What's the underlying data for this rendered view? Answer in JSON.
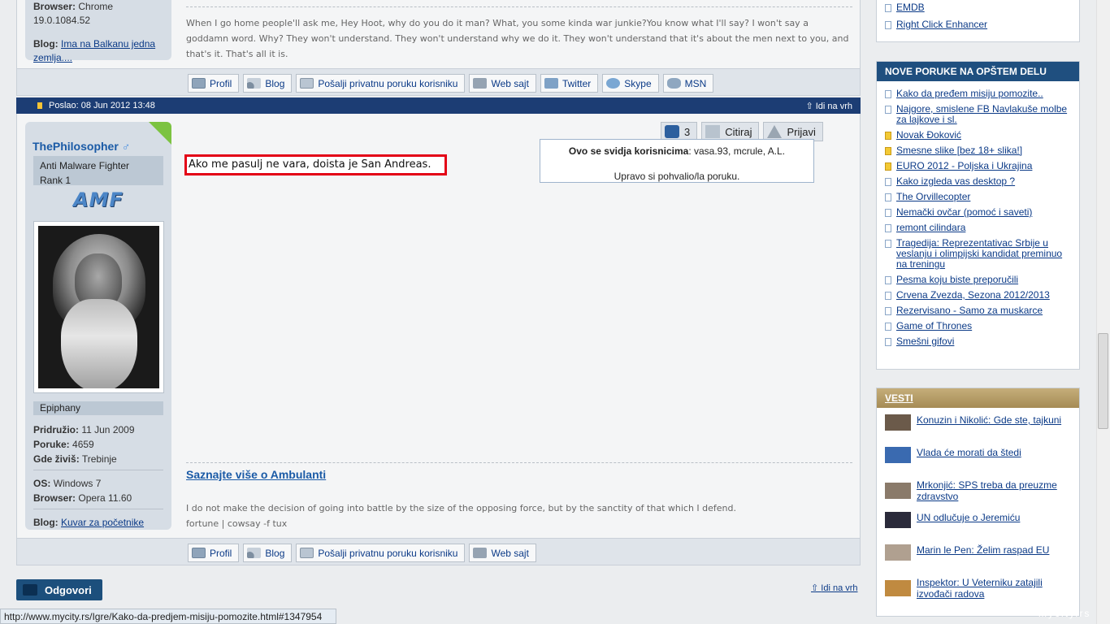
{
  "prev_post": {
    "browser_label": "Browser:",
    "browser_value": "Chrome 19.0.1084.52",
    "blog_label": "Blog:",
    "blog_link": "Ima na Balkanu jedna zemlja....",
    "signature": "When I go home people'll ask me, Hey Hoot, why do you do it man? What, you some kinda war junkie?You know what I'll say? I won't say a goddamn word. Why? They won't understand. They won't understand why we do it. They won't understand that it's about the men next to you, and that's it. That's all it is."
  },
  "buttons_top": [
    "Profil",
    "Blog",
    "Pošalji privatnu poruku korisniku",
    "Web sajt",
    "Twitter",
    "Skype",
    "MSN"
  ],
  "buttons_bottom": [
    "Profil",
    "Blog",
    "Pošalji privatnu poruku korisniku",
    "Web sajt"
  ],
  "post_header": {
    "date": "Poslao: 08 Jun 2012 13:48",
    "top_link": "Idi na vrh"
  },
  "user": {
    "name": "ThePhilosopher",
    "sex_symbol": "♂",
    "rank_line1": "Anti Malware Fighter",
    "rank_line2": "Rank 1",
    "badge": "AMF",
    "title": "Epiphany",
    "joined_label": "Pridružio:",
    "joined": "11 Jun 2009",
    "posts_label": "Poruke:",
    "posts": "4659",
    "location_label": "Gde živiš:",
    "location": "Trebinje",
    "os_label": "OS:",
    "os": "Windows 7",
    "browser_label": "Browser:",
    "browser": "Opera 11.60",
    "blog_label": "Blog:",
    "blog_link": "Kuvar za početnike"
  },
  "actions": {
    "like_count": "3",
    "quote": "Citiraj",
    "report": "Prijavi"
  },
  "message": "Ako me pasulj ne vara, doista je San Andreas.",
  "like_popup": {
    "label": "Ovo se svidja korisnicima",
    "users": "vasa.93, mcrule, A.L.",
    "note": "Upravo si pohvalio/la poruku."
  },
  "signature": {
    "link": "Saznajte više o Ambulanti",
    "line1": "I do not make the decision of going into battle by the size of the opposing force, but by the sanctity of that which I defend.",
    "line2": "fortune | cowsay -f tux"
  },
  "reply_button": "Odgovori",
  "bottom_top_link": "Idi na vrh",
  "status_url": "http://www.mycity.rs/Igre/Kako-da-predjem-misiju-pomozite.html#1347954",
  "sidebar_top_links": [
    "EMDB",
    "Right Click Enhancer"
  ],
  "new_posts": {
    "title": "NOVE PORUKE NA OPŠTEM DELU",
    "items": [
      {
        "text": "Kako da pređem misiju pomozite..",
        "hot": false
      },
      {
        "text": "Najgore, smislene FB Navlakuše molbe za lajkove i sl.",
        "hot": false
      },
      {
        "text": "Novak Đoković",
        "hot": true
      },
      {
        "text": "Smesne slike [bez 18+ slika!]",
        "hot": true
      },
      {
        "text": "EURO 2012 - Poljska i Ukrajina",
        "hot": true
      },
      {
        "text": "Kako izgleda vas desktop ?",
        "hot": false
      },
      {
        "text": "The Orvillecopter",
        "hot": false
      },
      {
        "text": "Nemački ovčar (pomoć i saveti)",
        "hot": false
      },
      {
        "text": "remont cilindara",
        "hot": false
      },
      {
        "text": "Tragedija: Reprezentativac Srbije u veslanju i olimpijski kandidat preminuo na treningu",
        "hot": false
      },
      {
        "text": "Pesma koju biste preporučili",
        "hot": false
      },
      {
        "text": "Crvena Zvezda, Sezona 2012/2013",
        "hot": false
      },
      {
        "text": "Rezervisano - Samo za muskarce",
        "hot": false
      },
      {
        "text": "Game of Thrones",
        "hot": false
      },
      {
        "text": "Smešni gifovi",
        "hot": false
      }
    ]
  },
  "news": {
    "title": "VESTI",
    "items": [
      "Konuzin i Nikolić: Gde ste, tajkuni",
      "Vlada će morati da štedi",
      "Mrkonjić: SPS treba da preuzme zdravstvo",
      "UN odlučuje o Jeremiću",
      "Marin le Pen: Želim raspad EU",
      "Inspektor: U Veterniku zatajili izvođači radova"
    ]
  },
  "watermark": "mycity.rs"
}
